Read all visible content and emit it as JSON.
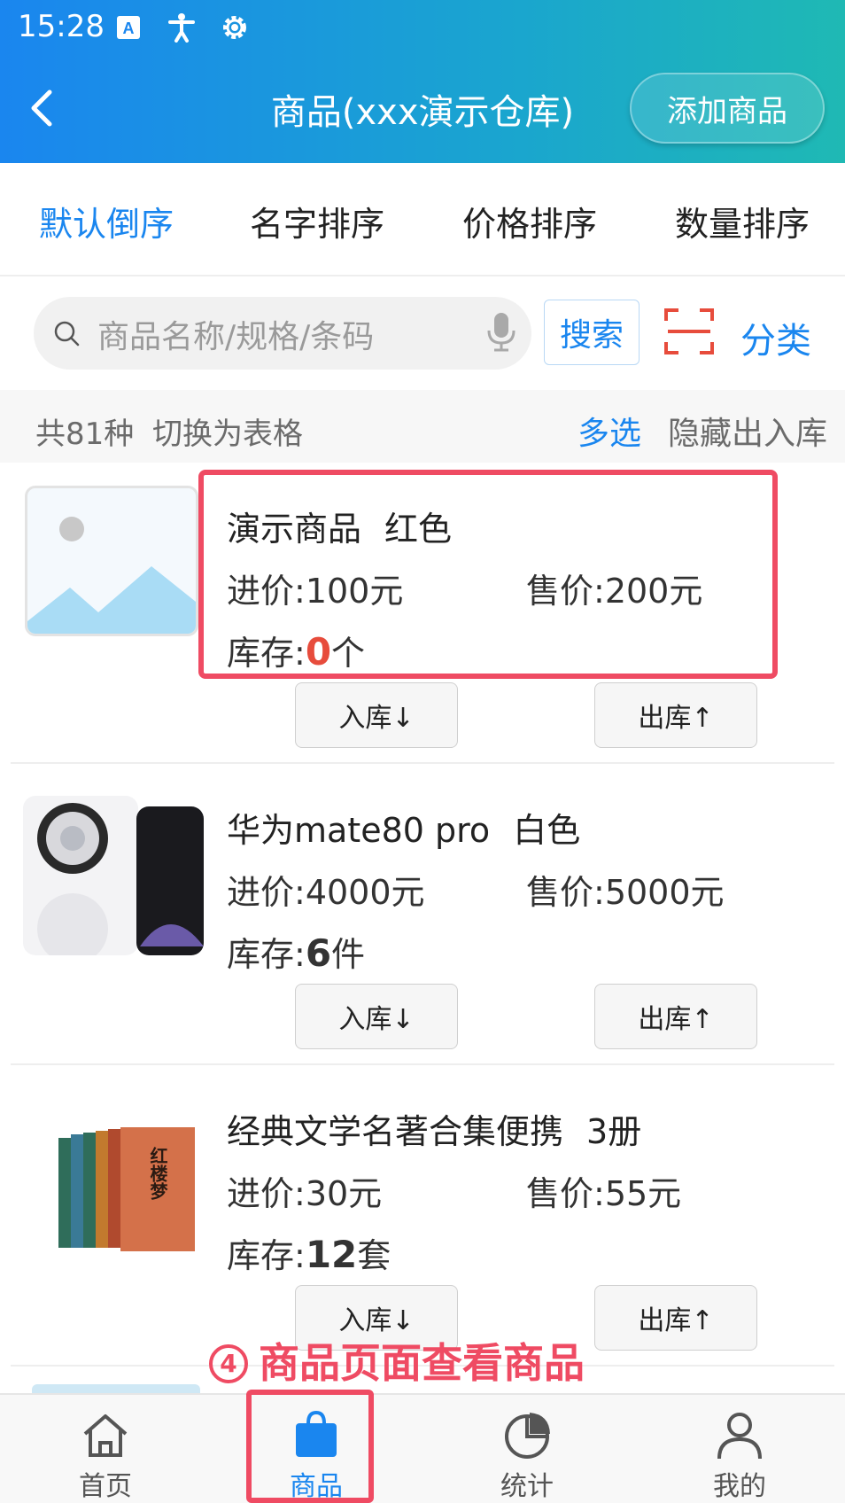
{
  "status_bar": {
    "time": "15:28",
    "icons": [
      "font-a-icon",
      "accessibility-icon",
      "settings-gear-icon"
    ]
  },
  "header": {
    "title": "商品(xxx演示仓库)",
    "add_button": "添加商品"
  },
  "sort_tabs": [
    {
      "label": "默认倒序",
      "active": true
    },
    {
      "label": "名字排序",
      "active": false
    },
    {
      "label": "价格排序",
      "active": false
    },
    {
      "label": "数量排序",
      "active": false
    }
  ],
  "search": {
    "placeholder": "商品名称/规格/条码",
    "button": "搜索",
    "category": "分类"
  },
  "list_info": {
    "total": "共81种",
    "toggle": "切换为表格",
    "multi_select": "多选",
    "hide_io": "隐藏出入库"
  },
  "products": [
    {
      "name": "演示商品",
      "spec": "红色",
      "cost_label": "进价:",
      "cost": "100元",
      "sale_label": "售价:",
      "sale": "200元",
      "stock_label": "库存:",
      "stock": "0",
      "unit": "个",
      "in_button": "入库↓",
      "out_button": "出库↑",
      "image": "placeholder-image-icon"
    },
    {
      "name": "华为mate80 pro",
      "spec": "白色",
      "cost_label": "进价:",
      "cost": "4000元",
      "sale_label": "售价:",
      "sale": "5000元",
      "stock_label": "库存:",
      "stock": "6",
      "unit": "件",
      "in_button": "入库↓",
      "out_button": "出库↑",
      "image": "phone-image"
    },
    {
      "name": "经典文学名著合集便携",
      "spec": "3册",
      "cost_label": "进价:",
      "cost": "30元",
      "sale_label": "售价:",
      "sale": "55元",
      "stock_label": "库存:",
      "stock": "12",
      "unit": "套",
      "in_button": "入库↓",
      "out_button": "出库↑",
      "image": "book-set-image",
      "book_title": "红楼梦"
    }
  ],
  "annotation": {
    "step": "4",
    "text": "商品页面查看商品"
  },
  "bottom_nav": [
    {
      "label": "首页",
      "icon": "home-icon",
      "active": false
    },
    {
      "label": "商品",
      "icon": "shopping-bag-icon",
      "active": true
    },
    {
      "label": "统计",
      "icon": "pie-chart-icon",
      "active": false
    },
    {
      "label": "我的",
      "icon": "user-icon",
      "active": false
    }
  ],
  "colors": {
    "primary": "#1a86ef",
    "highlight": "#ef4b63",
    "zero_stock": "#e74c3c"
  }
}
